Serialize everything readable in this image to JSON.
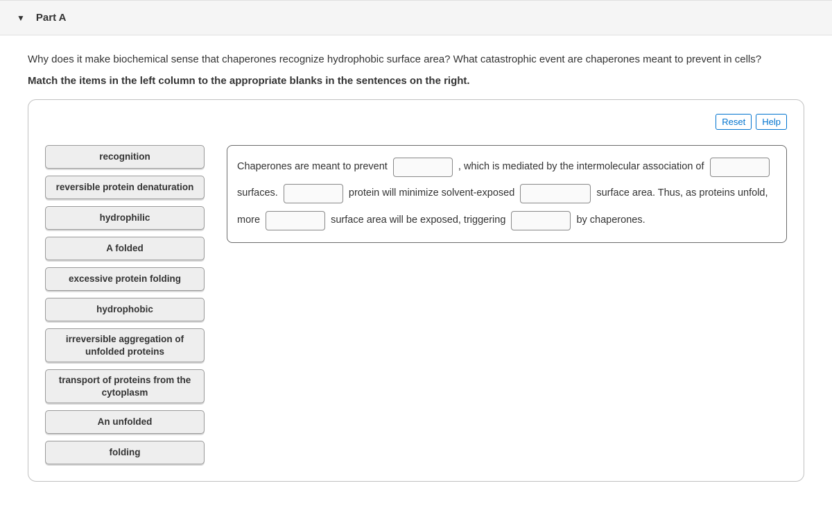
{
  "header": {
    "title": "Part A"
  },
  "question": "Why does it make biochemical sense that chaperones recognize hydrophobic surface area? What catastrophic event are chaperones meant to prevent in cells?",
  "instruction": "Match the items in the left column to the appropriate blanks in the sentences on the right.",
  "buttons": {
    "reset": "Reset",
    "help": "Help"
  },
  "drag_items": [
    "recognition",
    "reversible protein denaturation",
    "hydrophilic",
    "A folded",
    "excessive protein folding",
    "hydrophobic",
    "irreversible aggregation of unfolded proteins",
    "transport of proteins from the cytoplasm",
    "An unfolded",
    "folding"
  ],
  "sentence": {
    "s1": "Chaperones are meant to prevent",
    "s2": ", which is mediated by the intermolecular association",
    "s3": "of",
    "s4": "surfaces.",
    "s5": "protein will minimize solvent-exposed",
    "s6": "surface",
    "s7": "area. Thus, as proteins unfold, more",
    "s8": "surface area will be exposed, triggering",
    "s9": "by chaperones."
  }
}
